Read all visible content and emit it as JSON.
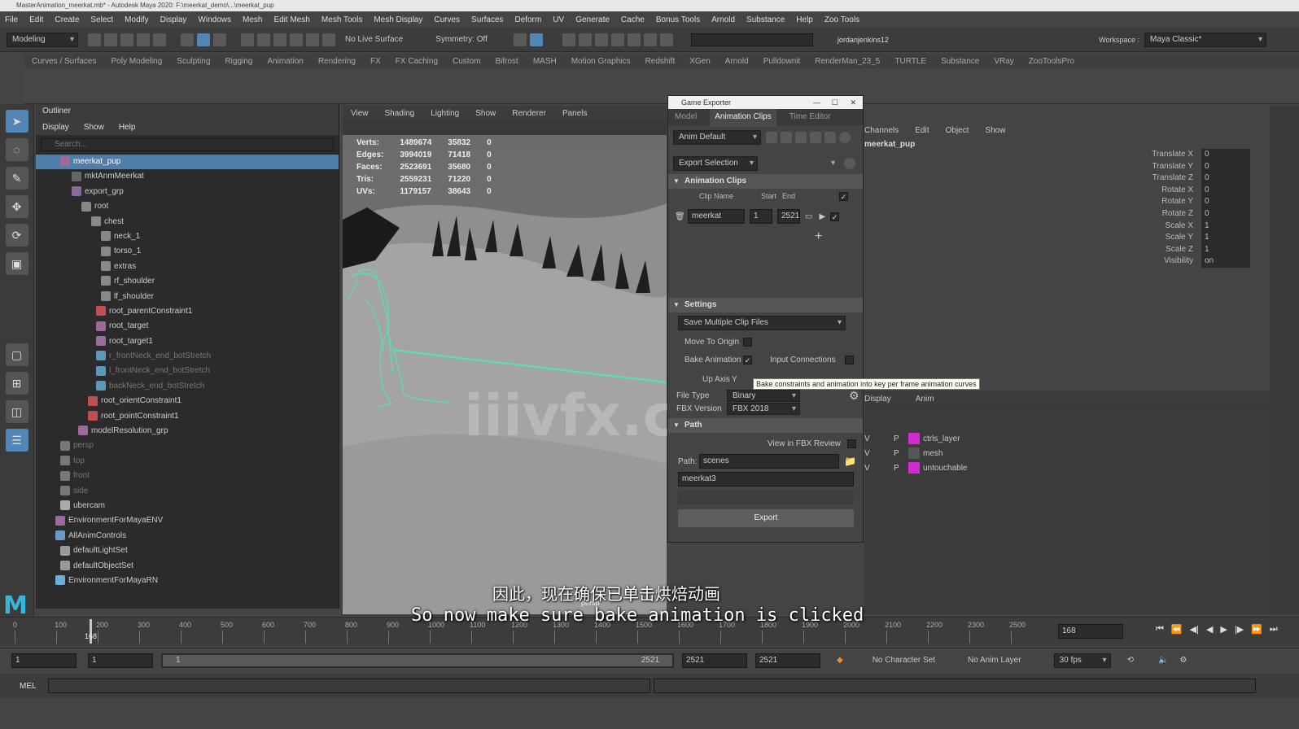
{
  "app": {
    "title": "MasterAnimation_meerkat.mb* - Autodesk Maya 2020: F:\\meerkat_demo\\...\\meerkat_pup"
  },
  "menu": [
    "File",
    "Edit",
    "Create",
    "Select",
    "Modify",
    "Display",
    "Windows",
    "Mesh",
    "Edit Mesh",
    "Mesh Tools",
    "Mesh Display",
    "Curves",
    "Surfaces",
    "Deform",
    "UV",
    "Generate",
    "Cache",
    "Bonus Tools",
    "Arnold",
    "Substance",
    "Help",
    "Zoo Tools"
  ],
  "workspace": {
    "label": "Workspace :",
    "value": "Maya Classic*"
  },
  "status": {
    "mode": "Modeling",
    "live_surface": "No Live Surface",
    "symmetry": "Symmetry: Off",
    "user": "jordanjenkins12"
  },
  "shelf_tabs": [
    "Curves / Surfaces",
    "Poly Modeling",
    "Sculpting",
    "Rigging",
    "Animation",
    "Rendering",
    "FX",
    "FX Caching",
    "Custom",
    "Bifrost",
    "MASH",
    "Motion Graphics",
    "Redshift",
    "XGen",
    "Arnold",
    "Pulldownit",
    "RenderMan_23_5",
    "TURTLE",
    "Substance",
    "VRay",
    "ZooToolsPro"
  ],
  "outliner": {
    "title": "Outliner",
    "menu": [
      "Display",
      "Show",
      "Help"
    ],
    "search_placeholder": "Search...",
    "items": [
      {
        "label": "meerkat_pup",
        "selected": true
      },
      {
        "label": "mktAnmMeerkat"
      },
      {
        "label": "export_grp"
      },
      {
        "label": "root"
      },
      {
        "label": "chest"
      },
      {
        "label": "neck_1"
      },
      {
        "label": "torso_1"
      },
      {
        "label": "extras"
      },
      {
        "label": "rf_shoulder"
      },
      {
        "label": "lf_shoulder"
      },
      {
        "label": "root_parentConstraint1"
      },
      {
        "label": "root_target"
      },
      {
        "label": "root_target1"
      },
      {
        "label": "r_frontNeck_end_botStretch",
        "dim": true
      },
      {
        "label": "l_frontNeck_end_botStretch",
        "dim": true
      },
      {
        "label": "backNeck_end_botStretch",
        "dim": true
      },
      {
        "label": "root_orientConstraint1"
      },
      {
        "label": "root_pointConstraint1"
      },
      {
        "label": "modelResolution_grp"
      },
      {
        "label": "persp",
        "dim": true
      },
      {
        "label": "top",
        "dim": true
      },
      {
        "label": "front",
        "dim": true
      },
      {
        "label": "side",
        "dim": true
      },
      {
        "label": "ubercam"
      },
      {
        "label": "EnvironmentForMayaENV"
      },
      {
        "label": "AllAnimControls"
      },
      {
        "label": "defaultLightSet"
      },
      {
        "label": "defaultObjectSet"
      },
      {
        "label": "EnvironmentForMayaRN"
      }
    ]
  },
  "viewport": {
    "menu": [
      "View",
      "Shading",
      "Lighting",
      "Show",
      "Renderer",
      "Panels"
    ],
    "camera": "persp",
    "hud": [
      {
        "label": "Verts:",
        "a": "1489674",
        "b": "35832",
        "c": "0"
      },
      {
        "label": "Edges:",
        "a": "3994019",
        "b": "71418",
        "c": "0"
      },
      {
        "label": "Faces:",
        "a": "2523691",
        "b": "35680",
        "c": "0"
      },
      {
        "label": "Tris:",
        "a": "2559231",
        "b": "71220",
        "c": "0"
      },
      {
        "label": "UVs:",
        "a": "1179157",
        "b": "38643",
        "c": "0"
      }
    ],
    "watermark": "iiivfx.com"
  },
  "game_exporter": {
    "title": "Game Exporter",
    "tabs": [
      "Model",
      "Animation Clips",
      "Time Editor"
    ],
    "preset": "Anim Default",
    "export_mode": "Export Selection",
    "clips_section": "Animation Clips",
    "clip_headers": {
      "name": "Clip Name",
      "start": "Start",
      "end": "End"
    },
    "clip": {
      "name": "meerkat",
      "start": "1",
      "end": "2521"
    },
    "settings_section": "Settings",
    "save_mode": "Save Multiple Clip Files",
    "move_to_origin": "Move To Origin",
    "bake_animation": "Bake Animation",
    "input_connections": "Input Connections",
    "up_axis_label": "Up Axis",
    "up_axis": "Y",
    "file_type_label": "File Type",
    "file_type": "Binary",
    "fbx_version_label": "FBX Version",
    "fbx_version": "FBX 2018",
    "path_section": "Path",
    "view_in_fbx_review": "View in FBX Review",
    "path_label": "Path:",
    "path": "scenes",
    "filename": "meerkat3",
    "export_button": "Export",
    "tooltip": "Bake constraints and animation into key per frame animation curves"
  },
  "channel_box": {
    "menu": [
      "Channels",
      "Edit",
      "Object",
      "Show"
    ],
    "object": "meerkat_pup",
    "attrs": [
      {
        "name": "Translate X",
        "value": "0"
      },
      {
        "name": "Translate Y",
        "value": "0"
      },
      {
        "name": "Translate Z",
        "value": "0"
      },
      {
        "name": "Rotate X",
        "value": "0"
      },
      {
        "name": "Rotate Y",
        "value": "0"
      },
      {
        "name": "Rotate Z",
        "value": "0"
      },
      {
        "name": "Scale X",
        "value": "1"
      },
      {
        "name": "Scale Y",
        "value": "1"
      },
      {
        "name": "Scale Z",
        "value": "1"
      },
      {
        "name": "Visibility",
        "value": "on"
      }
    ]
  },
  "layers": {
    "tabs": [
      "Display",
      "Anim"
    ],
    "items": [
      {
        "v": "V",
        "p": "P",
        "name": "ctrls_layer",
        "color": "#d22ad2"
      },
      {
        "v": "V",
        "p": "P",
        "name": "mesh",
        "color": "#555555"
      },
      {
        "v": "V",
        "p": "P",
        "name": "untouchable",
        "color": "#d22ad2"
      }
    ]
  },
  "timeline": {
    "ticks": [
      "0",
      "100",
      "200",
      "300",
      "400",
      "500",
      "600",
      "700",
      "800",
      "900",
      "1000",
      "1100",
      "1200",
      "1300",
      "1400",
      "1500",
      "1600",
      "1700",
      "1800",
      "1900",
      "2000",
      "2100",
      "2200",
      "2300",
      "2500"
    ],
    "current": "168",
    "current_field": "168"
  },
  "range": {
    "start": "1",
    "start2": "1",
    "slider_start": "1",
    "slider_end": "2521",
    "end1": "2521",
    "end2": "2521",
    "character_set": "No Character Set",
    "anim_layer": "No Anim Layer",
    "fps": "30 fps"
  },
  "cmdline": {
    "label": "MEL"
  },
  "subtitles": {
    "zh": "因此，现在确保已单击烘焙动画",
    "en": "So now make sure bake animation is clicked"
  },
  "colors": {
    "accent": "#4f7ea8",
    "mesh": "#4fe8a8",
    "layer_magenta": "#d22ad2"
  }
}
